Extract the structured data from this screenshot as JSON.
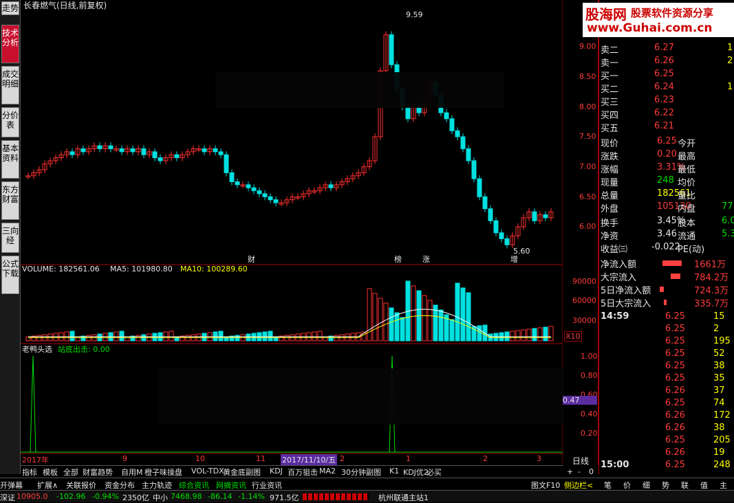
{
  "chart": {
    "title": "长春燃气(日线,前复权)",
    "high_label": "9.59",
    "low_label": "5.60",
    "price_ticks": [
      "9.00",
      "8.50",
      "8.00",
      "7.50",
      "7.00",
      "6.50",
      "6.00"
    ],
    "event_markers": [
      "财",
      "榜",
      "涨",
      "增"
    ],
    "volume_label": "VOLUME: 182561.06",
    "ma5_label": "MA5: 101980.80",
    "ma10_label": "MA10: 100289.60",
    "vol_ticks": [
      "90000",
      "60000",
      "30000"
    ],
    "x10": "X10",
    "ind_title": "老鸭头选",
    "ind_sub": "站底出击: 0.00",
    "ind_ticks": [
      "1.00",
      "0.80",
      "0.60",
      "0.40",
      "0.20"
    ],
    "ind_marker": "0.47",
    "date_labels": [
      "2017年",
      "9",
      "10",
      "11",
      "2",
      "1",
      "2",
      "3"
    ],
    "date_highlight": "2017/11/10/五"
  },
  "sidebar": [
    "技术分析",
    "成交明细",
    "分价表",
    "基本资料",
    "东方财富",
    "三向经",
    "公式下载"
  ],
  "sidebar_top": "走势",
  "logo": {
    "name": "股海网",
    "slogan": "股票软件资源分享",
    "url": "www.Guhai.com.cn"
  },
  "orderbook": [
    [
      "卖二",
      "6.27",
      "1"
    ],
    [
      "卖一",
      "6.26",
      "2"
    ],
    [
      "买一",
      "6.25",
      ""
    ],
    [
      "买二",
      "6.24",
      "1"
    ],
    [
      "买三",
      "6.23",
      ""
    ],
    [
      "买四",
      "6.22",
      ""
    ],
    [
      "买五",
      "6.21",
      ""
    ]
  ],
  "quote": [
    [
      "现价",
      "6.25",
      "今开",
      ""
    ],
    [
      "涨跌",
      "0.20",
      "最高",
      ""
    ],
    [
      "涨幅",
      "3.31%",
      "最低",
      ""
    ],
    [
      "现量",
      "248",
      "均价",
      ""
    ],
    [
      "总量",
      "182561",
      "量比",
      ""
    ],
    [
      "外盘",
      "105130",
      "内盘",
      "77"
    ],
    [
      "换手",
      "3.45%",
      "股本",
      "6.0"
    ],
    [
      "净资",
      "3.46",
      "流通",
      "5.3"
    ],
    [
      "收益㈢",
      "-0.022",
      "PE(动)",
      ""
    ]
  ],
  "flows": [
    [
      "净流入额",
      "1661万"
    ],
    [
      "大宗流入",
      "784.2万"
    ],
    [
      "5日净流入额",
      "724.3万"
    ],
    [
      "5日大宗流入",
      "335.7万"
    ]
  ],
  "ticks": [
    [
      "14:59",
      "6.25",
      "15"
    ],
    [
      "",
      "6.25",
      "2"
    ],
    [
      "",
      "6.25",
      "195"
    ],
    [
      "",
      "6.25",
      "52"
    ],
    [
      "",
      "6.25",
      "38"
    ],
    [
      "",
      "6.25",
      "35"
    ],
    [
      "",
      "6.26",
      "37"
    ],
    [
      "",
      "6.25",
      "74"
    ],
    [
      "",
      "6.26",
      "172"
    ],
    [
      "",
      "6.26",
      "38"
    ],
    [
      "",
      "6.25",
      "205"
    ],
    [
      "",
      "6.26",
      "19"
    ],
    [
      "15:00",
      "6.25",
      "248"
    ]
  ],
  "toolbar": [
    "指标",
    "模板",
    "全部",
    "财富趋势",
    "自用M",
    "橙子味操盘",
    "VOL-TDX",
    "黄金底副图",
    "KDJ",
    "百万狙击",
    "MA2",
    "30分钟副图",
    "K1",
    "KDJ优2",
    "必买"
  ],
  "period": "日线",
  "ctrls": [
    "+",
    "-",
    "0"
  ],
  "bottom1": [
    "开弹幕",
    "扩展∧",
    "关联报价",
    "资金分布",
    "主力轨迹",
    "综合资讯",
    "网摘资讯",
    "行业资讯",
    "图文F10",
    "侧边栏<",
    "笔",
    "价",
    "细",
    "势",
    "联",
    "值",
    "主"
  ],
  "bottom2": {
    "idx1": "深证",
    "idx1_val": "10905.0",
    "idx1_chg": "-102.96",
    "idx1_pct": "-0.94%",
    "idx1_amt": "2350亿",
    "idx2": "中小",
    "idx2_val": "7468.98",
    "idx2_chg": "-86.14",
    "idx2_pct": "-1.14%",
    "idx2_amt": "971.5亿",
    "server": "杭州联通主站1"
  }
}
